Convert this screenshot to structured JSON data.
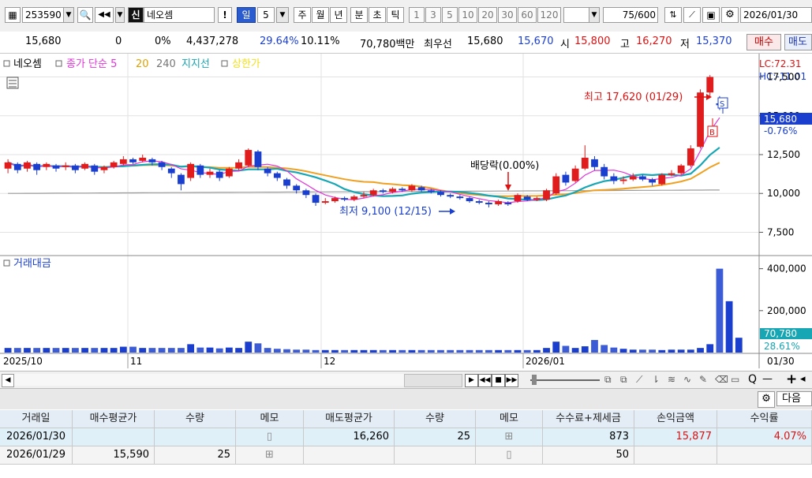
{
  "toolbar": {
    "code": "253590",
    "credit_badge": "신",
    "stock_name": "네오셈",
    "excl": "!",
    "period_day": "일",
    "period_num": "5",
    "periods": [
      "주",
      "월",
      "년",
      "분",
      "초",
      "틱"
    ],
    "minutes": [
      "1",
      "3",
      "5",
      "10",
      "20",
      "30",
      "60",
      "120"
    ],
    "count": "75",
    "count_total": "/600",
    "date": "2026/01/30"
  },
  "quote": {
    "price": "15,680",
    "change": "0",
    "change_pct": "0%",
    "volume": "4,437,278",
    "vol_rate": "29.64%",
    "turnover": "10.11%",
    "amount": "70,780백만",
    "best_label": "최우선",
    "best_ask": "15,680",
    "best_bid": "15,670",
    "open_label": "시",
    "open": "15,800",
    "high_label": "고",
    "high": "16,270",
    "low_label": "저",
    "low": "15,370",
    "buy_btn": "매수",
    "sell_btn": "매도"
  },
  "chart": {
    "legend": {
      "name": "네오셈",
      "ma_label": "종가 단순 5",
      "ma20": "20",
      "ma240": "240",
      "support": "지지선",
      "upper_limit": "상한가"
    },
    "lc_label": "LC:72.31",
    "hc_label": "HC:-11.01",
    "price_ticks": [
      "17,500",
      "15,000",
      "12,500",
      "10,000",
      "7,500"
    ],
    "current_price_tag": "15,680",
    "current_pct_tag": "-0.76%",
    "high_annotation": "최고 17,620 (01/29)",
    "low_annotation": "최저 9,100 (12/15)",
    "dividend_annotation": "배당락(0.00%)",
    "buy_marker": "B",
    "sell_marker": "S",
    "volume_label": "거래대금",
    "volume_ticks": [
      "400,000",
      "200,000"
    ],
    "volume_tag": "70,780",
    "volume_pct_tag": "28.61%",
    "date_labels": [
      "2025/10",
      "11",
      "12",
      "2026/01"
    ],
    "date_right": "01/30"
  },
  "chart_data": {
    "type": "candlestick",
    "ylim": [
      6000,
      19000
    ],
    "candles": [
      {
        "o": 11600,
        "c": 12000,
        "h": 12200,
        "l": 11300
      },
      {
        "o": 11900,
        "c": 11500,
        "h": 12000,
        "l": 11300
      },
      {
        "o": 11600,
        "c": 12000,
        "h": 12100,
        "l": 11400
      },
      {
        "o": 11900,
        "c": 11500,
        "h": 12000,
        "l": 11200
      },
      {
        "o": 11700,
        "c": 11900,
        "h": 12000,
        "l": 11500
      },
      {
        "o": 11800,
        "c": 11600,
        "h": 11900,
        "l": 11400
      },
      {
        "o": 11700,
        "c": 11800,
        "h": 12000,
        "l": 11500
      },
      {
        "o": 11800,
        "c": 11500,
        "h": 11900,
        "l": 11300
      },
      {
        "o": 11600,
        "c": 11900,
        "h": 12000,
        "l": 11500
      },
      {
        "o": 11800,
        "c": 11400,
        "h": 11900,
        "l": 11200
      },
      {
        "o": 11500,
        "c": 11700,
        "h": 11800,
        "l": 11300
      },
      {
        "o": 11700,
        "c": 12000,
        "h": 12100,
        "l": 11600
      },
      {
        "o": 11900,
        "c": 12200,
        "h": 12400,
        "l": 11800
      },
      {
        "o": 12200,
        "c": 12000,
        "h": 12300,
        "l": 11900
      },
      {
        "o": 12100,
        "c": 12300,
        "h": 12500,
        "l": 12000
      },
      {
        "o": 12200,
        "c": 12000,
        "h": 12300,
        "l": 11800
      },
      {
        "o": 12000,
        "c": 11700,
        "h": 12100,
        "l": 11500
      },
      {
        "o": 11600,
        "c": 11300,
        "h": 11700,
        "l": 11000
      },
      {
        "o": 11200,
        "c": 10600,
        "h": 11300,
        "l": 10200
      },
      {
        "o": 11000,
        "c": 11900,
        "h": 12000,
        "l": 10800
      },
      {
        "o": 11800,
        "c": 11200,
        "h": 11900,
        "l": 11000
      },
      {
        "o": 11200,
        "c": 11400,
        "h": 11600,
        "l": 11000
      },
      {
        "o": 11400,
        "c": 11000,
        "h": 11500,
        "l": 10800
      },
      {
        "o": 11100,
        "c": 11600,
        "h": 11700,
        "l": 11000
      },
      {
        "o": 11600,
        "c": 12000,
        "h": 12200,
        "l": 11500
      },
      {
        "o": 11800,
        "c": 12800,
        "h": 12900,
        "l": 11700
      },
      {
        "o": 12700,
        "c": 11700,
        "h": 12800,
        "l": 11500
      },
      {
        "o": 11600,
        "c": 11300,
        "h": 11700,
        "l": 11100
      },
      {
        "o": 11300,
        "c": 11000,
        "h": 11400,
        "l": 10800
      },
      {
        "o": 10900,
        "c": 10500,
        "h": 11000,
        "l": 10300
      },
      {
        "o": 10500,
        "c": 10200,
        "h": 10600,
        "l": 10000
      },
      {
        "o": 10200,
        "c": 9900,
        "h": 10300,
        "l": 9700
      },
      {
        "o": 9900,
        "c": 9400,
        "h": 10000,
        "l": 9200
      },
      {
        "o": 9400,
        "c": 9500,
        "h": 9700,
        "l": 9300
      },
      {
        "o": 9500,
        "c": 9700,
        "h": 9800,
        "l": 9400
      },
      {
        "o": 9700,
        "c": 9600,
        "h": 9800,
        "l": 9500
      },
      {
        "o": 9600,
        "c": 9800,
        "h": 9900,
        "l": 9500
      },
      {
        "o": 9800,
        "c": 9900,
        "h": 10100,
        "l": 9700
      },
      {
        "o": 9900,
        "c": 10200,
        "h": 10300,
        "l": 9800
      },
      {
        "o": 10200,
        "c": 10100,
        "h": 10300,
        "l": 10000
      },
      {
        "o": 10100,
        "c": 10300,
        "h": 10400,
        "l": 10000
      },
      {
        "o": 10300,
        "c": 10200,
        "h": 10400,
        "l": 10100
      },
      {
        "o": 10200,
        "c": 10500,
        "h": 10600,
        "l": 10100
      },
      {
        "o": 10400,
        "c": 10200,
        "h": 10500,
        "l": 10100
      },
      {
        "o": 10200,
        "c": 10100,
        "h": 10300,
        "l": 10000
      },
      {
        "o": 10100,
        "c": 9900,
        "h": 10200,
        "l": 9800
      },
      {
        "o": 9900,
        "c": 9800,
        "h": 10000,
        "l": 9700
      },
      {
        "o": 9800,
        "c": 9700,
        "h": 9900,
        "l": 9600
      },
      {
        "o": 9700,
        "c": 9500,
        "h": 9800,
        "l": 9400
      },
      {
        "o": 9500,
        "c": 9400,
        "h": 9600,
        "l": 9300
      },
      {
        "o": 9400,
        "c": 9300,
        "h": 9500,
        "l": 9100
      },
      {
        "o": 9300,
        "c": 9500,
        "h": 9600,
        "l": 9200
      },
      {
        "o": 9400,
        "c": 9300,
        "h": 9500,
        "l": 9200
      },
      {
        "o": 9500,
        "c": 9900,
        "h": 10000,
        "l": 9400
      },
      {
        "o": 9800,
        "c": 9600,
        "h": 9900,
        "l": 9500
      },
      {
        "o": 9600,
        "c": 9700,
        "h": 9800,
        "l": 9500
      },
      {
        "o": 9600,
        "c": 10200,
        "h": 10300,
        "l": 9500
      },
      {
        "o": 10000,
        "c": 11100,
        "h": 11300,
        "l": 9900
      },
      {
        "o": 11200,
        "c": 10700,
        "h": 11400,
        "l": 10500
      },
      {
        "o": 10800,
        "c": 11600,
        "h": 11800,
        "l": 10700
      },
      {
        "o": 11600,
        "c": 12300,
        "h": 13100,
        "l": 11500
      },
      {
        "o": 12200,
        "c": 11700,
        "h": 12400,
        "l": 11500
      },
      {
        "o": 11700,
        "c": 11100,
        "h": 11900,
        "l": 10900
      },
      {
        "o": 11100,
        "c": 10800,
        "h": 11300,
        "l": 10600
      },
      {
        "o": 10800,
        "c": 10900,
        "h": 11100,
        "l": 10600
      },
      {
        "o": 10900,
        "c": 11100,
        "h": 11300,
        "l": 10800
      },
      {
        "o": 11100,
        "c": 10900,
        "h": 11200,
        "l": 10800
      },
      {
        "o": 10900,
        "c": 10700,
        "h": 11000,
        "l": 10500
      },
      {
        "o": 10600,
        "c": 11200,
        "h": 11300,
        "l": 10500
      },
      {
        "o": 11200,
        "c": 11300,
        "h": 11500,
        "l": 11100
      },
      {
        "o": 11300,
        "c": 11800,
        "h": 11900,
        "l": 11200
      },
      {
        "o": 11800,
        "c": 12900,
        "h": 13100,
        "l": 11700
      },
      {
        "o": 13000,
        "c": 16500,
        "h": 16700,
        "l": 12900
      },
      {
        "o": 16500,
        "c": 17500,
        "h": 17620,
        "l": 16200
      },
      {
        "o": 15800,
        "c": 15680,
        "h": 16270,
        "l": 15370
      }
    ],
    "volume": [
      22,
      22,
      22,
      22,
      22,
      22,
      22,
      22,
      22,
      22,
      22,
      22,
      28,
      28,
      22,
      22,
      22,
      22,
      22,
      40,
      24,
      24,
      20,
      24,
      22,
      52,
      44,
      22,
      18,
      16,
      14,
      14,
      12,
      12,
      12,
      12,
      12,
      12,
      12,
      12,
      12,
      12,
      12,
      12,
      12,
      12,
      12,
      12,
      12,
      12,
      12,
      12,
      12,
      12,
      12,
      12,
      22,
      52,
      32,
      22,
      30,
      60,
      36,
      24,
      18,
      14,
      14,
      14,
      12,
      14,
      14,
      14,
      22,
      40,
      400,
      245,
      70.78
    ]
  },
  "scroll_bar": {
    "search_symbol": "Q",
    "minus": "—",
    "plus": "+"
  },
  "panel": {
    "next_btn": "다음"
  },
  "table": {
    "headers": [
      "거래일",
      "매수평균가",
      "수량",
      "메모",
      "매도평균가",
      "수량",
      "메모",
      "수수료+제세금",
      "손익금액",
      "수익률"
    ],
    "rows": [
      [
        "2026/01/30",
        "",
        "",
        "",
        "16,260",
        "25",
        "",
        "873",
        "15,877",
        "4.07%"
      ],
      [
        "2026/01/29",
        "15,590",
        "25",
        "",
        "",
        "",
        "",
        "50",
        "",
        ""
      ]
    ]
  },
  "colors": {
    "up": "#e01c1c",
    "down": "#1a3fcf",
    "ma5": "#e034d8",
    "ma20": "#f0a020",
    "ma240": "#9b9b9b",
    "ma_support": "#17a6b3"
  }
}
